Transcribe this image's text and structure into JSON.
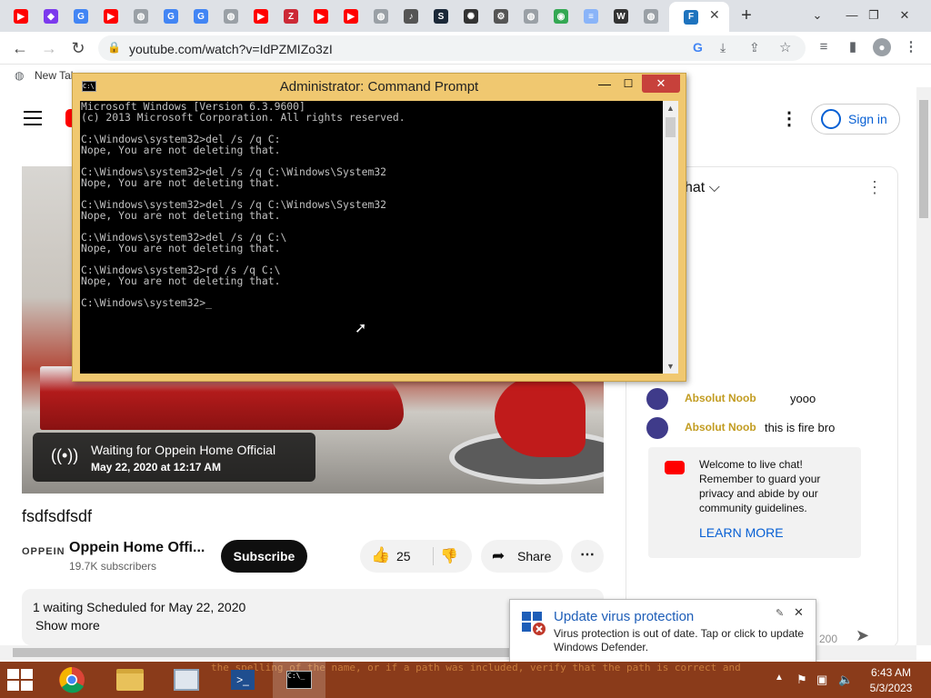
{
  "browser": {
    "tabs": [
      {
        "icon": "youtube-icon",
        "color": "#ff0000"
      },
      {
        "icon": "obsidian-icon",
        "color": "#7c3aed"
      },
      {
        "icon": "google-icon",
        "color": "#4285f4"
      },
      {
        "icon": "youtube-icon",
        "color": "#ff0000"
      },
      {
        "icon": "globe-icon",
        "color": "#9aa0a6"
      },
      {
        "icon": "google-icon",
        "color": "#4285f4"
      },
      {
        "icon": "google-icon",
        "color": "#4285f4"
      },
      {
        "icon": "globe-icon",
        "color": "#9aa0a6"
      },
      {
        "icon": "youtube-icon",
        "color": "#ff0000"
      },
      {
        "icon": "zotero-icon",
        "color": "#cc2936"
      },
      {
        "icon": "youtube-icon",
        "color": "#ff0000"
      },
      {
        "icon": "youtube-icon",
        "color": "#ff0000"
      },
      {
        "icon": "globe-icon",
        "color": "#9aa0a6"
      },
      {
        "icon": "speaker-icon",
        "color": "#555555"
      },
      {
        "icon": "steam-icon",
        "color": "#1b2838"
      },
      {
        "icon": "openai-icon",
        "color": "#333333"
      },
      {
        "icon": "gear-icon",
        "color": "#555555"
      },
      {
        "icon": "globe-icon",
        "color": "#9aa0a6"
      },
      {
        "icon": "maps-icon",
        "color": "#34a853"
      },
      {
        "icon": "google-docs-icon",
        "color": "#8ab4f8"
      },
      {
        "icon": "wikipedia-icon",
        "color": "#333333"
      },
      {
        "icon": "globe-icon",
        "color": "#9aa0a6"
      },
      {
        "icon": "file-explorer-icon",
        "color": "#1e73be"
      }
    ],
    "close_glyph": "✕",
    "new_tab_glyph": "+",
    "url": "youtube.com/watch?v=IdPZMIZo3zI",
    "bookmark": "New Tab"
  },
  "cmd": {
    "title": "Administrator:  Command Prompt",
    "minimize": "—",
    "maximize": "☐",
    "close": "✕",
    "lines": "Microsoft Windows [Version 6.3.9600]\n(c) 2013 Microsoft Corporation. All rights reserved.\n\nC:\\Windows\\system32>del /s /q C:\nNope, You are not deleting that.\n\nC:\\Windows\\system32>del /s /q C:\\Windows\\System32\nNope, You are not deleting that.\n\nC:\\Windows\\system32>del /s /q C:\\Windows\\System32\nNope, You are not deleting that.\n\nC:\\Windows\\system32>del /s /q C:\\\nNope, You are not deleting that.\n\nC:\\Windows\\system32>rd /s /q C:\\\nNope, You are not deleting that.\n\nC:\\Windows\\system32>_"
  },
  "youtube": {
    "sign_in": "Sign in",
    "waiting_title": "Waiting for Oppein Home Official",
    "waiting_date": "May 22, 2020 at 12:17 AM",
    "video_title": "fsdfsdfsdf",
    "channel_logo": "OPPEIN",
    "channel_name": "Oppein Home Offi...",
    "subscribers": "19.7K subscribers",
    "subscribe": "Subscribe",
    "likes": "25",
    "share": "Share",
    "description_meta": "1 waiting  Scheduled for May 22, 2020",
    "show_more": "Show more",
    "chat": {
      "title_fragment": "hat",
      "messages": [
        {
          "author": "Absolut Noob",
          "text": "yooo"
        },
        {
          "author": "Absolut Noob",
          "text": "this is fire bro"
        }
      ],
      "welcome": "Welcome to live chat! Remember to guard your privacy and abide by our community guidelines.",
      "learn_more": "LEARN MORE",
      "char_count": "200"
    }
  },
  "toast": {
    "title": "Update virus protection",
    "body": "Virus protection is out of date. Tap or click to update Windows Defender."
  },
  "taskbar": {
    "apps": [
      {
        "name": "chrome-icon"
      },
      {
        "name": "file-explorer-icon"
      },
      {
        "name": "resource-monitor-icon"
      },
      {
        "name": "powershell-icon"
      },
      {
        "name": "command-prompt-icon"
      }
    ],
    "background_text": "the spelling of the name, or if a path was included, verify that the path is correct and",
    "time": "6:43 AM",
    "date": "5/3/2023"
  }
}
